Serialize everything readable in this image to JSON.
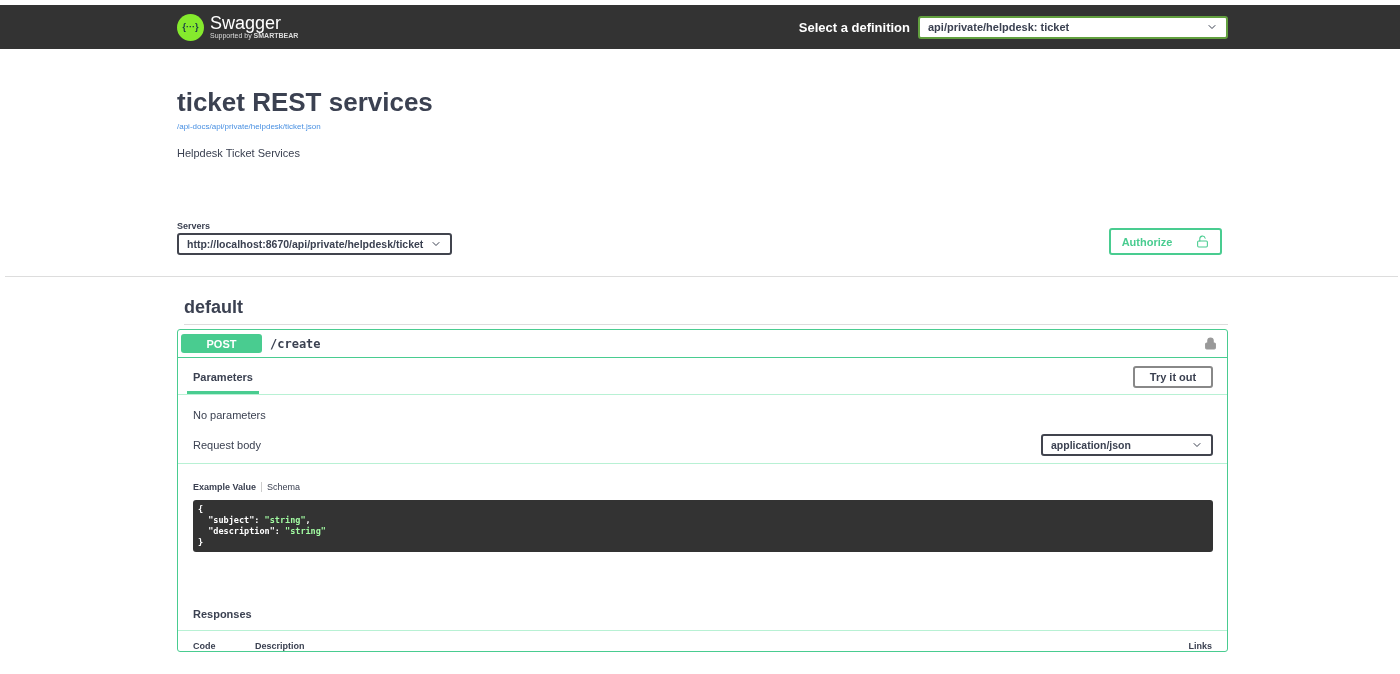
{
  "topbar": {
    "logo_mark": "{···}",
    "brand": "Swagger",
    "tagline": "Supported by",
    "tagline_brand": "SMARTBEAR",
    "definition_label": "Select a definition",
    "definition_value": "api/private/helpdesk: ticket"
  },
  "info": {
    "title": "ticket REST services",
    "url": "/api-docs/api/private/helpdesk/ticket.json",
    "description": "Helpdesk Ticket Services"
  },
  "servers": {
    "label": "Servers",
    "value": "http://localhost:8670/api/private/helpdesk/ticket"
  },
  "authorize": {
    "label": "Authorize"
  },
  "section": {
    "title": "default"
  },
  "operation": {
    "method": "POST",
    "path": "/create",
    "locked": true,
    "tabs": [
      {
        "label": "Parameters",
        "selected": true
      }
    ],
    "try_button": "Try it out",
    "no_params": "No parameters",
    "request_body_label": "Request body",
    "content_type": "application/json",
    "example_tabs": [
      {
        "label": "Example Value",
        "selected": true
      },
      {
        "label": "Schema",
        "selected": false
      }
    ],
    "example": {
      "open": "{",
      "close": "}",
      "lines": [
        {
          "key": "\"subject\":",
          "value": "\"string\"",
          "trail": ","
        },
        {
          "key": "\"description\":",
          "value": "\"string\""
        }
      ]
    },
    "responses_title": "Responses",
    "response_columns": [
      "Code",
      "Description",
      "Links"
    ]
  }
}
